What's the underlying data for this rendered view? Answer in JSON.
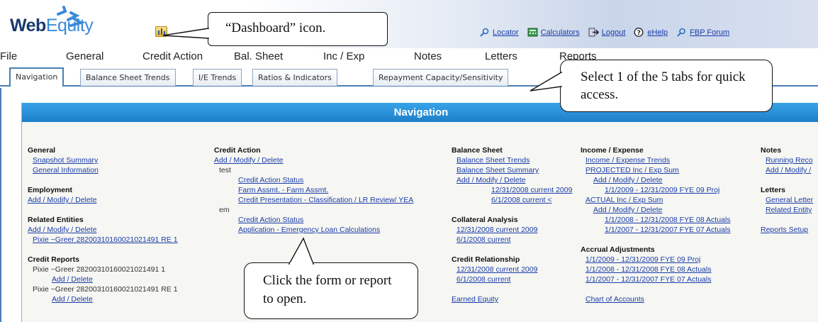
{
  "header": {
    "logo_web": "Web",
    "logo_equity": "Equity",
    "links": [
      {
        "label": "Locator",
        "icon": "search-icon"
      },
      {
        "label": "Calculators",
        "icon": "calculator-icon"
      },
      {
        "label": "Logout",
        "icon": "logout-icon"
      },
      {
        "label": "eHelp",
        "icon": "help-icon"
      },
      {
        "label": "FBP Forum",
        "icon": "forum-icon"
      }
    ]
  },
  "menu": [
    "File",
    "General",
    "Credit Action",
    "Bal. Sheet",
    "Inc / Exp",
    "Notes",
    "Letters",
    "Reports"
  ],
  "tabs": [
    "Navigation",
    "Balance Sheet Trends",
    "I/E Trends",
    "Ratios & Indicators",
    "Repayment Capacity/Sensitivity"
  ],
  "panel": {
    "title": "Navigation"
  },
  "general": {
    "heading": "General",
    "items": [
      "Snapshot Summary",
      "General Information"
    ],
    "employment_heading": "Employment",
    "employment_link": "Add / Modify / Delete",
    "related_heading": "Related Entities",
    "related_link": "Add / Modify / Delete",
    "related_entity": "Pixie ~Greer 28200310160021021491 RE 1",
    "credit_reports_heading": "Credit Reports",
    "cr_entity1": "Pixie ~Greer 28200310160021021491 1",
    "cr_link1": "Add / Delete",
    "cr_entity2": "Pixie ~Greer 28200310160021021491 RE 1",
    "cr_link2": "Add / Delete"
  },
  "credit_action": {
    "heading": "Credit Action",
    "add_link": "Add / Modify / Delete",
    "group1": "test",
    "g1_items": [
      "Credit Action Status",
      "Farm Assmt. - Farm Assmt.",
      "Credit Presentation - Classification / LR Review/ YEA"
    ],
    "group2": "em",
    "g2_items": [
      "Credit Action Status",
      "Application - Emergency Loan Calculations"
    ]
  },
  "balance_sheet": {
    "heading": "Balance Sheet",
    "items": [
      "Balance Sheet Trends",
      "Balance Sheet Summary",
      "Add / Modify / Delete"
    ],
    "sub_items": [
      "12/31/2008 current 2009",
      "6/1/2008 current <"
    ],
    "collateral_heading": "Collateral Analysis",
    "collateral_items": [
      "12/31/2008 current 2009",
      "6/1/2008 current"
    ],
    "relationship_heading": "Credit Relationship",
    "relationship_items": [
      "12/31/2008 current 2009",
      "6/1/2008 current"
    ],
    "earned_equity": "Earned Equity"
  },
  "income_expense": {
    "heading": "Income / Expense",
    "trends": "Income / Expense Trends",
    "projected": "PROJECTED Inc / Exp Sum",
    "proj_add": "Add / Modify / Delete",
    "proj_item": "1/1/2009 - 12/31/2009 FYE 09 Proj",
    "actual": "ACTUAL Inc / Exp Sum",
    "act_add": "Add / Modify / Delete",
    "act_items": [
      "1/1/2008 - 12/31/2008 FYE 08 Actuals",
      "1/1/2007 - 12/31/2007 FYE 07 Actuals"
    ],
    "accrual_heading": "Accrual Adjustments",
    "accrual_items": [
      "1/1/2009 - 12/31/2009 FYE 09 Proj",
      "1/1/2008 - 12/31/2008 FYE 08 Actuals",
      "1/1/2007 - 12/31/2007 FYE 07 Actuals"
    ],
    "chart_accounts": "Chart of Accounts"
  },
  "notes": {
    "heading": "Notes",
    "items": [
      "Running Reco",
      "Add / Modify /"
    ],
    "letters_heading": "Letters",
    "letters_items": [
      "General Letter",
      "Related Entity"
    ],
    "reports_setup": "Reports Setup"
  },
  "callouts": {
    "dashboard": "“Dashboard” icon.",
    "tabs": "Select 1 of the 5 tabs for quick access.",
    "form": "Click the form or report to open."
  }
}
